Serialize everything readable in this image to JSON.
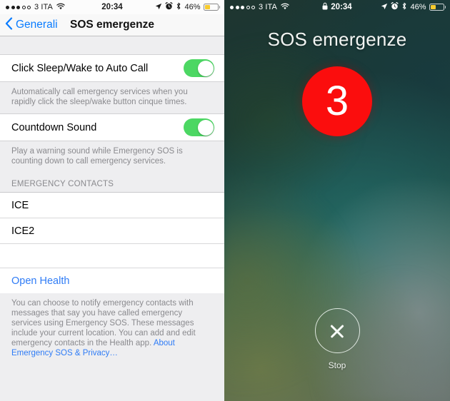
{
  "left": {
    "status_bar": {
      "signal_dots_filled": 3,
      "signal_dots_hollow": 2,
      "carrier": "3 ITA",
      "wifi_icon": "wifi-icon",
      "time": "20:34",
      "location_icon": "location-arrow-icon",
      "alarm_icon": "alarm-clock-icon",
      "bluetooth_icon": "bluetooth-icon",
      "battery_percent": "46%",
      "battery_level": 46,
      "battery_color": "#f7cb2e"
    },
    "navbar": {
      "back_icon": "chevron-left-icon",
      "back_label": "Generali",
      "title": "SOS emergenze"
    },
    "rows": [
      {
        "label": "Click Sleep/Wake to Auto Call",
        "toggle": true,
        "toggle_on": true
      },
      {
        "label": "Countdown Sound",
        "toggle": true,
        "toggle_on": true
      }
    ],
    "footnotes": {
      "auto_call": "Automatically call emergency services when you rapidly click the sleep/wake button cinque times.",
      "countdown": "Play a warning sound while Emergency SOS is counting down to call emergency services."
    },
    "section_header": "EMERGENCY CONTACTS",
    "contacts": [
      "ICE",
      "ICE2",
      ""
    ],
    "open_health": "Open Health",
    "privacy_footnote": {
      "text": "You can choose to notify emergency contacts with messages that say you have called emergency services using Emergency SOS. These messages include your current location. You can add and edit emergency contacts in the Health app. ",
      "link": "About Emergency SOS & Privacy…"
    },
    "accent_color": "#2f7cf6",
    "toggle_on_color": "#4cd763"
  },
  "right": {
    "status_bar": {
      "signal_dots_filled": 3,
      "signal_dots_hollow": 2,
      "carrier": "3 ITA",
      "wifi_icon": "wifi-icon",
      "lock_icon": "lock-icon",
      "time": "20:34",
      "location_icon": "location-arrow-icon",
      "alarm_icon": "alarm-clock-icon",
      "bluetooth_icon": "bluetooth-icon",
      "battery_percent": "46%",
      "battery_level": 46,
      "battery_color": "#f7cb2e"
    },
    "title": "SOS emergenze",
    "countdown_value": "3",
    "countdown_color": "#fb0d0d",
    "stop_icon": "close-x-icon",
    "stop_label": "Stop"
  }
}
